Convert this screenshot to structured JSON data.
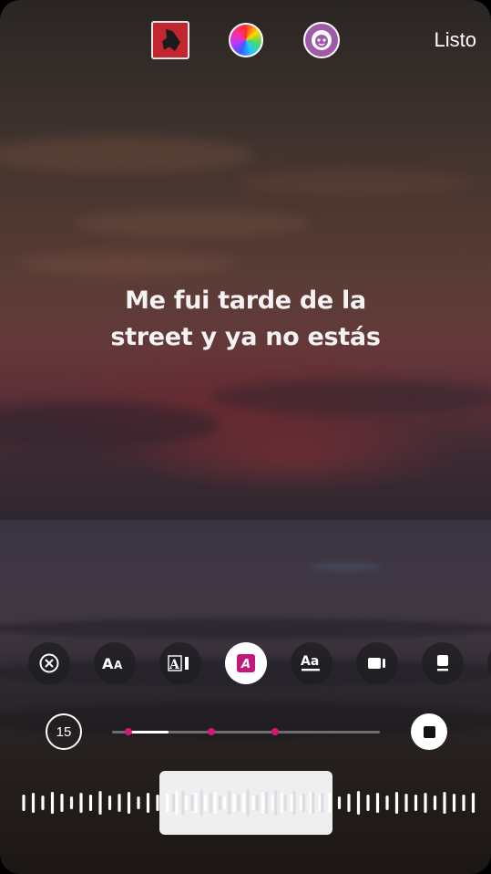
{
  "header": {
    "album_icon": "album-art",
    "color_icon": "color-wheel-icon",
    "effects_icon": "face-effects-icon",
    "done_label": "Listo"
  },
  "lyrics": {
    "line1": "Me fui tarde de la",
    "line2": "street y ya no estás"
  },
  "style_options": [
    {
      "name": "remove-lyrics-icon",
      "active": false
    },
    {
      "name": "text-style-aa-icon",
      "active": false
    },
    {
      "name": "text-style-ai-icon",
      "active": false
    },
    {
      "name": "text-style-italic-a-icon",
      "active": true
    },
    {
      "name": "text-style-underline-aa-icon",
      "active": false
    },
    {
      "name": "video-card-icon",
      "active": false
    },
    {
      "name": "album-card-icon",
      "active": false
    }
  ],
  "playback": {
    "duration_label": "15",
    "progress": 0.15,
    "markers": [
      0.06,
      0.37,
      0.61
    ],
    "accent_color": "#d6157a"
  }
}
